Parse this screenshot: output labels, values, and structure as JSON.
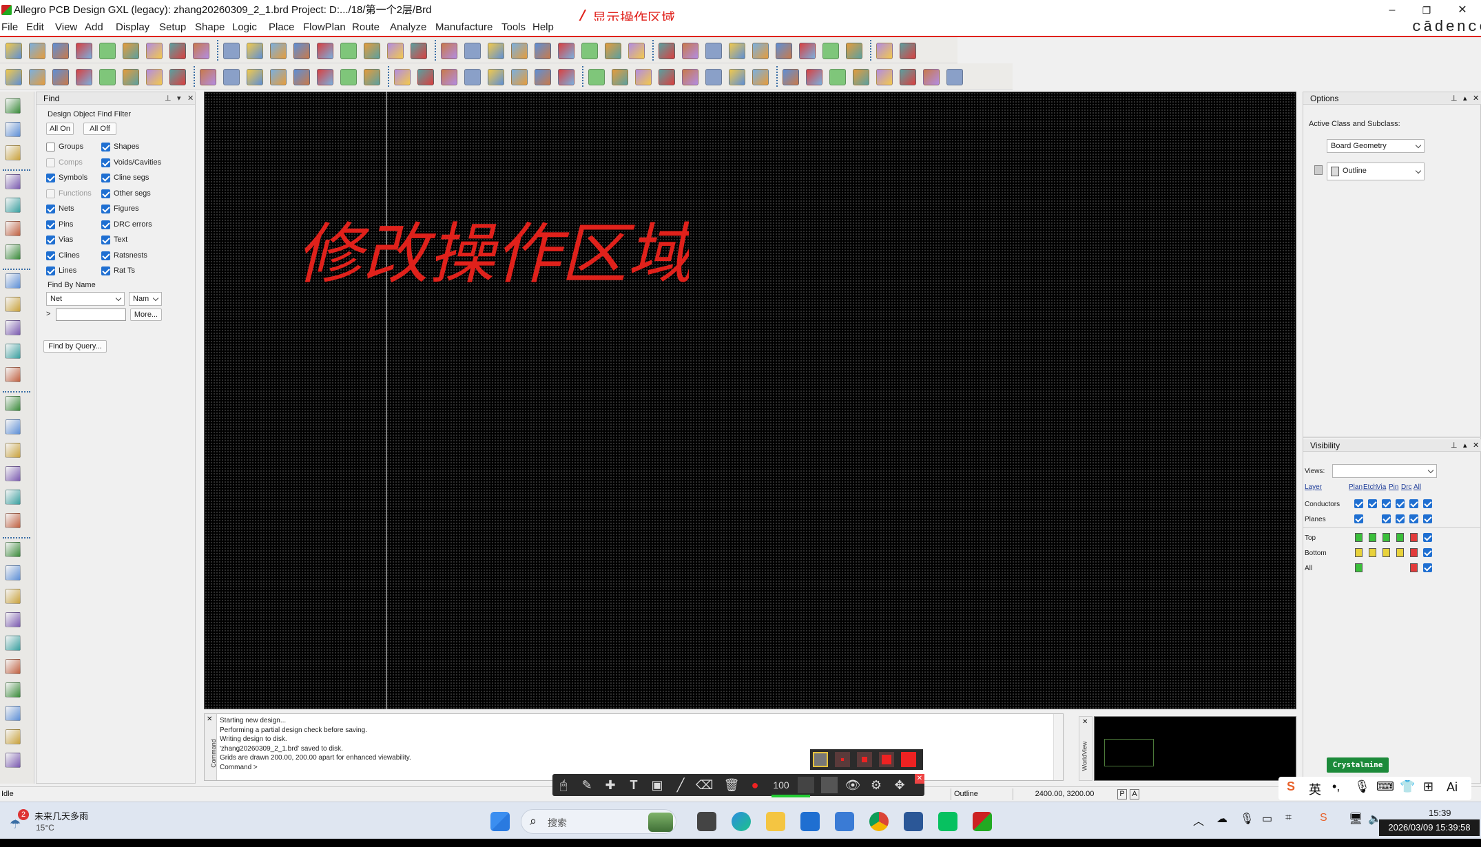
{
  "title_bar": {
    "title": "Allegro PCB Design GXL (legacy): zhang20260309_2_1.brd  Project: D:.../18/第一个2层/Brd",
    "minimize": "–",
    "maximize": "❐",
    "close": "✕"
  },
  "annotation_top": "显示操作区域",
  "annotation_canvas": "修改操作区域",
  "brand": "cādence",
  "menu": [
    "File",
    "Edit",
    "View",
    "Add",
    "Display",
    "Setup",
    "Shape",
    "Logic",
    "Place",
    "FlowPlan",
    "Route",
    "Analyze",
    "Manufacture",
    "Tools",
    "Help"
  ],
  "find_panel": {
    "title": "Find",
    "filter_title": "Design Object Find Filter",
    "all_on": "All On",
    "all_off": "All Off",
    "left_items": [
      {
        "label": "Groups",
        "checked": false,
        "disabled": false
      },
      {
        "label": "Comps",
        "checked": false,
        "disabled": true
      },
      {
        "label": "Symbols",
        "checked": true,
        "disabled": false
      },
      {
        "label": "Functions",
        "checked": false,
        "disabled": true
      },
      {
        "label": "Nets",
        "checked": true,
        "disabled": false
      },
      {
        "label": "Pins",
        "checked": true,
        "disabled": false
      },
      {
        "label": "Vias",
        "checked": true,
        "disabled": false
      },
      {
        "label": "Clines",
        "checked": true,
        "disabled": false
      },
      {
        "label": "Lines",
        "checked": true,
        "disabled": false
      }
    ],
    "right_items": [
      {
        "label": "Shapes",
        "checked": true
      },
      {
        "label": "Voids/Cavities",
        "checked": true
      },
      {
        "label": "Cline segs",
        "checked": true
      },
      {
        "label": "Other segs",
        "checked": true
      },
      {
        "label": "Figures",
        "checked": true
      },
      {
        "label": "DRC errors",
        "checked": true
      },
      {
        "label": "Text",
        "checked": true
      },
      {
        "label": "Ratsnests",
        "checked": true
      },
      {
        "label": "Rat Ts",
        "checked": true
      }
    ],
    "find_by_name": "Find By Name",
    "type_value": "Net",
    "name_value": "Nam",
    "prompt": ">",
    "more": "More...",
    "find_by_query": "Find by Query..."
  },
  "options_panel": {
    "title": "Options",
    "active_label": "Active Class and Subclass:",
    "class_value": "Board Geometry",
    "subclass_value": "Outline"
  },
  "visibility_panel": {
    "title": "Visibility",
    "views_label": "Views:",
    "headers": [
      "Layer",
      "Plan",
      "Etch",
      "Via",
      "Pin",
      "Drc",
      "All"
    ],
    "rows": [
      {
        "label": "Conductors",
        "cells": [
          "check",
          "check",
          "check",
          "check",
          "check",
          "check"
        ]
      },
      {
        "label": "Planes",
        "cells": [
          "check",
          "",
          "check",
          "check",
          "check",
          "check"
        ]
      },
      {
        "label": "Top",
        "cells": [
          "#3bbf3b",
          "#3bbf3b",
          "#3bbf3b",
          "#3bbf3b",
          "#e23b3b",
          "check"
        ]
      },
      {
        "label": "Bottom",
        "cells": [
          "#e8d23a",
          "#e8d23a",
          "#e8d23a",
          "#e8d23a",
          "#e23b3b",
          "check"
        ]
      },
      {
        "label": "All",
        "cells": [
          "#3bbf3b",
          "",
          "",
          "",
          "#e23b3b",
          "check"
        ]
      }
    ]
  },
  "console": {
    "lines": [
      "Starting new design...",
      "Performing a partial design check before saving.",
      "Writing design to disk.",
      "'zhang20260309_2_1.brd' saved to disk.",
      "Grids are drawn 200.00, 200.00 apart for enhanced viewability.",
      "Command >"
    ],
    "side_label": "Command",
    "worldview_label": "WorldView"
  },
  "status_bar": {
    "state": "Idle",
    "subclass": "Outline",
    "coords": "2400.00, 3200.00",
    "p": "P",
    "a": "A"
  },
  "float_toolbar": {
    "zoom": "100"
  },
  "crystal_badge": "Crystalmine",
  "ime": {
    "lang": "英",
    "ai": "Ai"
  },
  "taskbar": {
    "weather_text": "未来几天多雨",
    "temp": "15°C",
    "weather_badge": "2",
    "search": "搜索",
    "time": "15:39",
    "datetime": "2026/03/09 15:39:58"
  }
}
